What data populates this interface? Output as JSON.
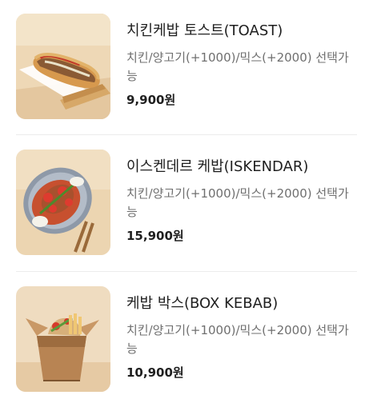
{
  "menu": {
    "items": [
      {
        "name": "치킨케밥 토스트(TOAST)",
        "description": "치킨/양고기(+1000)/믹스(+2000) 선택가능",
        "price": "9,900원",
        "image_icon": "kebab-toast-image"
      },
      {
        "name": "이스켄데르 케밥(ISKENDAR)",
        "description": "치킨/양고기(+1000)/믹스(+2000) 선택가능",
        "price": "15,900원",
        "image_icon": "iskender-kebab-image"
      },
      {
        "name": "케밥 박스(BOX KEBAB)",
        "description": "치킨/양고기(+1000)/믹스(+2000) 선택가능",
        "price": "10,900원",
        "image_icon": "box-kebab-image"
      }
    ]
  },
  "colors": {
    "background": "#ffffff",
    "name_text": "#1f1f1f",
    "desc_text": "#6f6f6f",
    "divider": "#ececec",
    "photo_wood": "#e8cfa8"
  }
}
